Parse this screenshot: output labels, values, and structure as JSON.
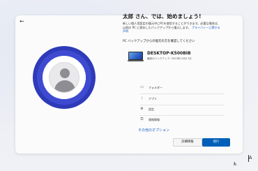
{
  "back_glyph": "←",
  "title": "太郎 さん、では、始めましょう!",
  "description": {
    "text": "新しい個人用設定の復元中にPCを使用することができます。必要な場合は、以前の PC に保存したバックアップから復元します。",
    "link": "プライバシーに関する声明"
  },
  "section_label": "PC バックアップからの復元の方を確認してください",
  "device": {
    "name": "DESKTOP-K500BIB",
    "subtitle": "最新のバックアップ: 2023年12月17日"
  },
  "backup_items": [
    {
      "icon": "folder-icon",
      "glyph": "▭",
      "label": "フォルダー"
    },
    {
      "icon": "apps-icon",
      "glyph": "⁞",
      "label": "アプリ"
    },
    {
      "icon": "settings-icon",
      "glyph": "⚙",
      "label": "設定"
    },
    {
      "icon": "credentials-icon",
      "glyph": "⚿",
      "label": "資格情報"
    }
  ],
  "other_options": "その他のオプション",
  "buttons": {
    "details": "詳細情報",
    "continue": "続行"
  },
  "tray": {
    "ime": "A"
  },
  "colors": {
    "accent": "#005fb8",
    "ring": "#3e4bd1",
    "link": "#1f5fbf"
  }
}
